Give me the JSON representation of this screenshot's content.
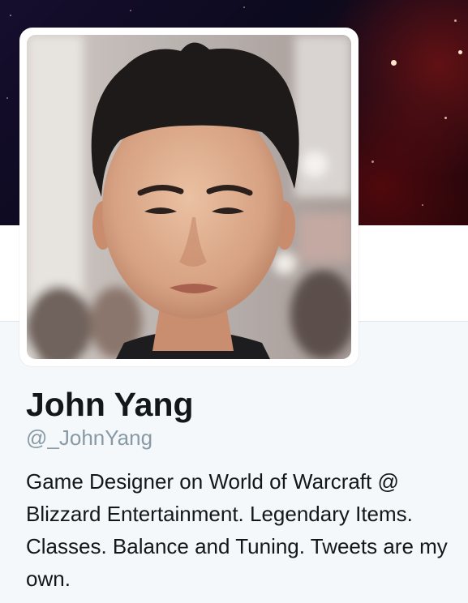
{
  "profile": {
    "name": "John Yang",
    "handle": "@_JohnYang",
    "bio": "Game Designer on World of Warcraft @ Blizzard Entertainment. Legendary Items. Classes. Balance and Tuning. Tweets are my own."
  },
  "icons": {
    "avatar": "profile-photo",
    "banner": "starfield-header-image"
  },
  "colors": {
    "name_text": "#14171a",
    "handle_text": "#8899a6",
    "bio_text": "#14171a",
    "content_background": "#f5f8fa",
    "banner_dark": "#0c0a1e",
    "banner_red": "#2a0508"
  }
}
